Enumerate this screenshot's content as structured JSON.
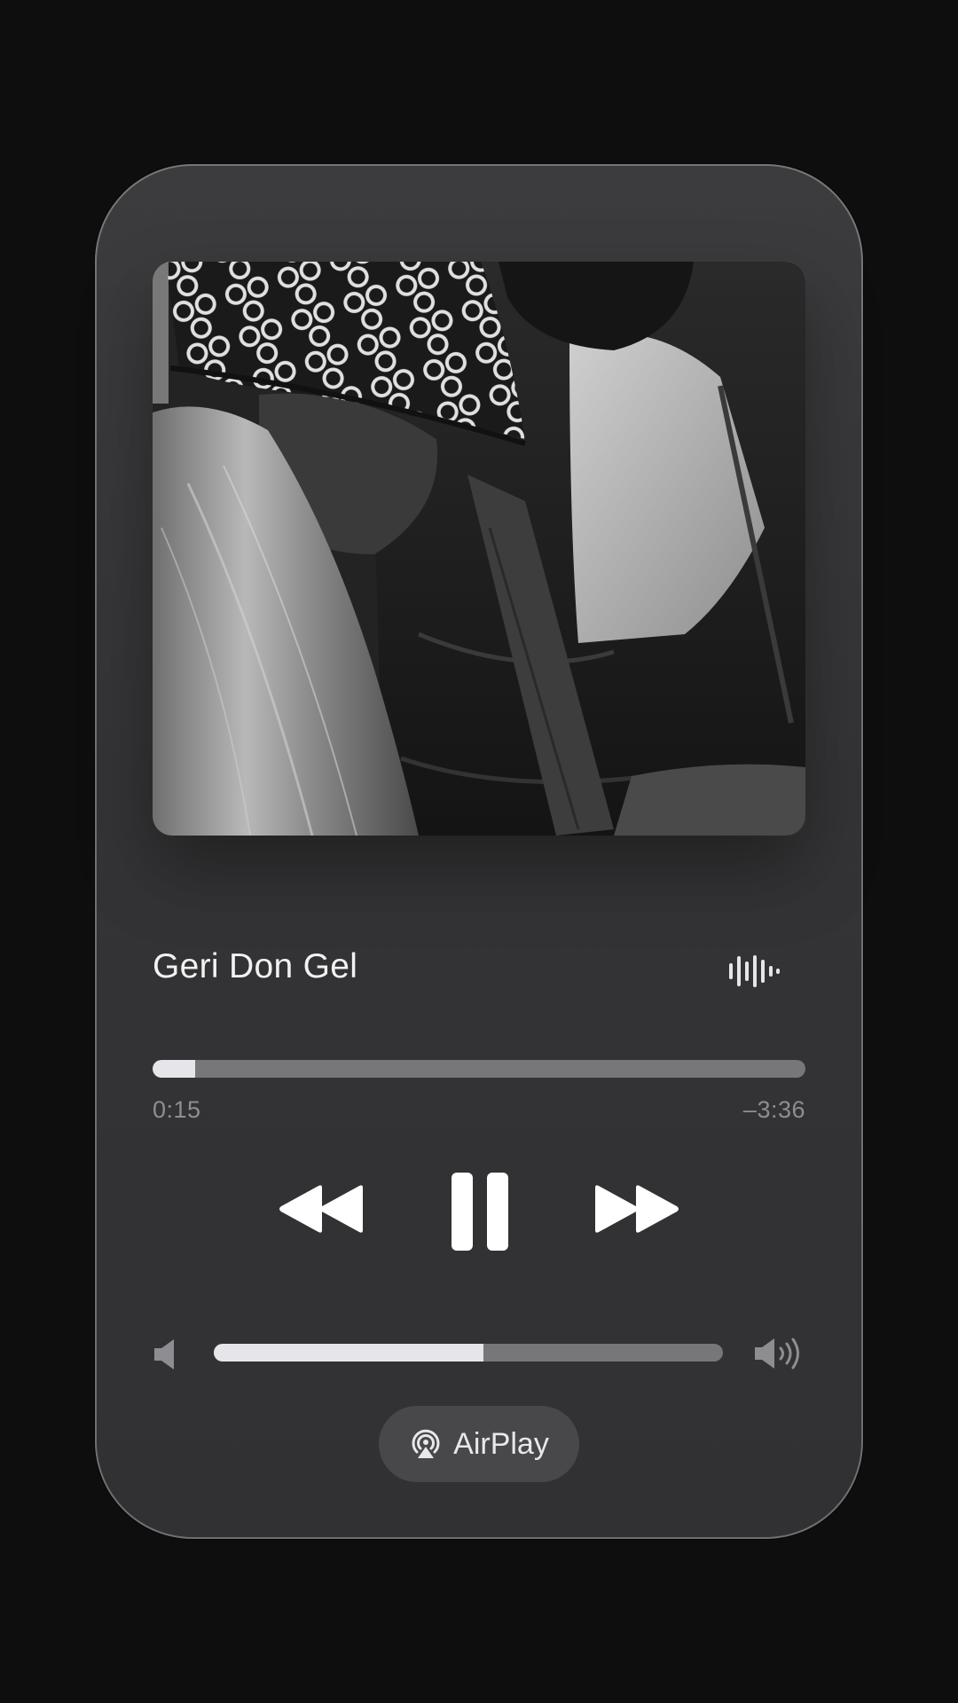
{
  "track": {
    "title": "Geri Don Gel"
  },
  "playback": {
    "elapsed": "0:15",
    "remaining": "–3:36",
    "progress_fraction": 0.065
  },
  "volume": {
    "level_fraction": 0.53
  },
  "controls": {
    "rewind_icon": "backward-icon",
    "pause_icon": "pause-icon",
    "forward_icon": "forward-icon",
    "waveform_icon": "waveform-icon"
  },
  "airplay": {
    "label": "AirPlay",
    "icon": "airplay-icon"
  },
  "colors": {
    "background": "#0e0e0f",
    "card": "#38383a",
    "track_fill": "#e6e6ea",
    "track_empty": "#77777a",
    "text_primary": "#f2f2f2",
    "text_secondary": "#8e8e92"
  }
}
